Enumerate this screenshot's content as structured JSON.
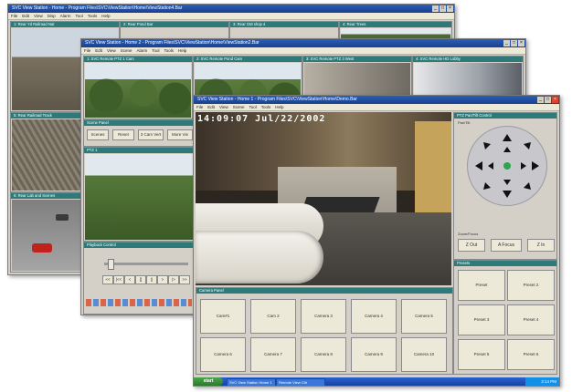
{
  "back_window": {
    "title": "SVC View Station - Home - Program Files\\SVC\\ViewStation\\Home\\ViewStation4.Bar",
    "menu": [
      "File",
      "Edit",
      "View",
      "Disp",
      "Alarm",
      "Tool",
      "Tools",
      "Help"
    ],
    "panes": [
      "1: Rear Yd Railroad Nat",
      "2: Rear Pond Bar",
      "3: Rear GM shop 4",
      "4: Rear Trees"
    ],
    "lower_panes": [
      "5: Rear Railroad Track",
      "6: Rear Lab and Scenes"
    ]
  },
  "middle_window": {
    "title": "SVC View Station - Home 2 - Program Files\\SVC\\ViewStation\\Home\\ViewStation2.Bar",
    "menu": [
      "File",
      "Edit",
      "View",
      "Scene",
      "Alarm",
      "Tool",
      "Tools",
      "Help"
    ],
    "panes": [
      "1: SVC Remote PTZ 1 Cam",
      "2: SVC Remote Pond Cam",
      "3: SVC Remote PTZ 3 West",
      "4: SVC Remote HD Lobby"
    ],
    "scene_panel_title": "Scene Panel",
    "scene_buttons": [
      "Scenes",
      "Reset",
      "3 Cam Vert",
      "More Vie"
    ],
    "ptz_pane_title": "PTZ 1",
    "playback_title": "Playback Control",
    "playback_buttons": [
      "<<",
      "|<<",
      "<",
      "[]",
      "||",
      ">",
      "|>",
      ">>"
    ]
  },
  "front_window": {
    "title": "SVC View Station - Home 1 - Program Files\\SVC\\ViewStation\\Home\\Demo.Bar",
    "menu": [
      "File",
      "Edit",
      "View",
      "Scene",
      "Tool",
      "Tools",
      "Help"
    ],
    "osd": "14:09:07 Jul/22/2002",
    "ptz_title": "PTZ Pan/Tilt Control",
    "ptz_group": "Pan/Tilt",
    "zoom_group": "Zoom/Focus",
    "zoom_buttons": [
      "Z Out",
      "A Focus",
      "Z In"
    ],
    "presets_group": "Presets",
    "presets": [
      "Preset",
      "Preset 2",
      "Preset 3",
      "Preset 4",
      "Preset 5",
      "Preset 6"
    ],
    "cameras_group": "Camera Panel",
    "camera_buttons": [
      "Cam#1",
      "Cam 2",
      "Camera 3",
      "Camera 4",
      "Camera 5",
      "Camera 6",
      "Camera 7",
      "Camera 8",
      "Camera 9",
      "Camera 10"
    ]
  },
  "taskbar": {
    "start": "start",
    "items": [
      "SVC View Station Home 1",
      "Remote View Ctrl"
    ],
    "clock": "3:14 PM"
  },
  "colors": {
    "titlebar": "#1a3f8e",
    "pane_title": "#2e7a7a",
    "window_bg": "#d4d0c8",
    "taskbar": "#1941a5"
  }
}
